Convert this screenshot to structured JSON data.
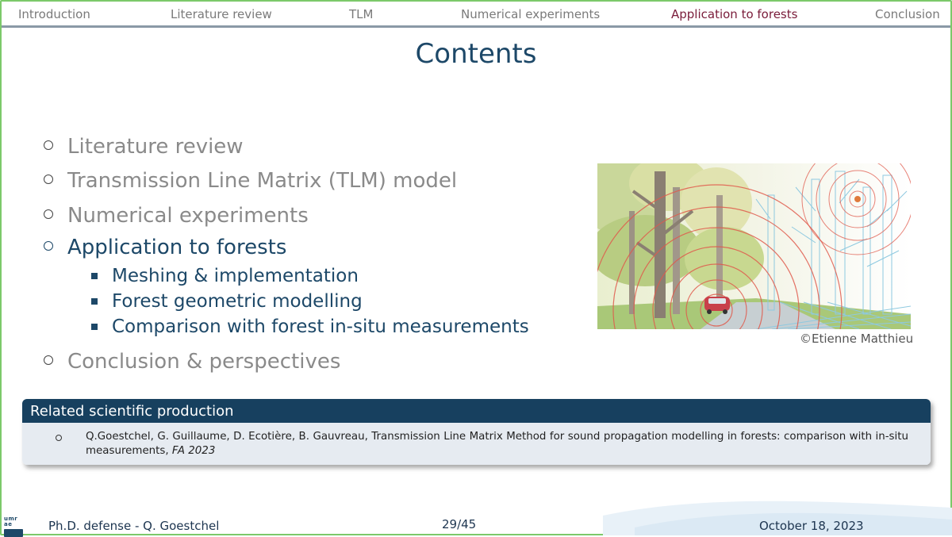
{
  "nav": {
    "items": [
      {
        "label": "Introduction"
      },
      {
        "label": "Literature review"
      },
      {
        "label": "TLM"
      },
      {
        "label": "Numerical experiments"
      },
      {
        "label": "Application to forests"
      },
      {
        "label": "Conclusion"
      }
    ],
    "active_index": 4
  },
  "slide": {
    "title": "Contents",
    "toc": [
      {
        "label": "Literature review"
      },
      {
        "label": "Transmission Line Matrix (TLM) model"
      },
      {
        "label": "Numerical experiments"
      },
      {
        "label": "Application to forests",
        "subitems": [
          {
            "label": "Meshing & implementation"
          },
          {
            "label": "Forest geometric modelling"
          },
          {
            "label": "Comparison with forest in-situ measurements"
          }
        ]
      },
      {
        "label": "Conclusion & perspectives"
      }
    ],
    "active_section": "Application to forests",
    "figure_credit": "©Etienne Matthieu"
  },
  "box": {
    "header": "Related scientific production",
    "text": "Q.Goestchel, G. Guillaume, D. Ecotière, B. Gauvreau, Transmission Line Matrix Method for sound propagation modelling in forests: comparison with in-situ measurements,",
    "venue": "FA 2023"
  },
  "footer": {
    "logo_text": "umr ae",
    "left": "Ph.D. defense - Q. Goestchel",
    "center": "29/45",
    "right": "October 18, 2023"
  },
  "colors": {
    "primary": "#1d4868",
    "active_nav": "#7a1c3a",
    "inactive": "#8a8a8a",
    "box_header": "#17405f",
    "box_body": "#e6ebf1",
    "frame": "#7cc96a"
  }
}
